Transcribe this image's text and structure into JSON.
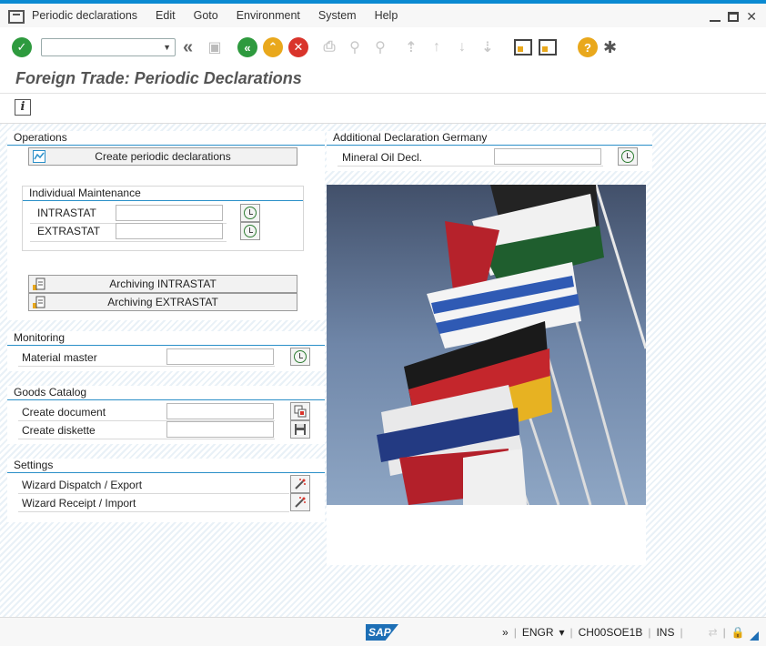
{
  "menu": {
    "items": [
      "Periodic declarations",
      "Edit",
      "Goto",
      "Environment",
      "System",
      "Help"
    ]
  },
  "page": {
    "title": "Foreign Trade: Periodic Declarations"
  },
  "operations": {
    "title": "Operations",
    "create_button": "Create periodic declarations",
    "individual_title": "Individual Maintenance",
    "intrastat_label": "INTRASTAT",
    "extrastat_label": "EXTRASTAT",
    "archiving_intrastat": "Archiving INTRASTAT",
    "archiving_extrastat": "Archiving EXTRASTAT"
  },
  "monitoring": {
    "title": "Monitoring",
    "material_master": "Material master"
  },
  "goods_catalog": {
    "title": "Goods Catalog",
    "create_document": "Create document",
    "create_diskette": "Create diskette"
  },
  "settings": {
    "title": "Settings",
    "wizard_dispatch": "Wizard Dispatch / Export",
    "wizard_receipt": "Wizard Receipt / Import"
  },
  "additional": {
    "title": "Additional Declaration Germany",
    "mineral_oil": "Mineral Oil Decl."
  },
  "statusbar": {
    "logo": "SAP",
    "arrows": "»",
    "language": "ENGR",
    "system": "CH00SOE1B",
    "mode": "INS"
  },
  "colors": {
    "accent": "#0a8ad2",
    "group_line": "#2a8fc8",
    "ok_green": "#2e9a3e"
  }
}
